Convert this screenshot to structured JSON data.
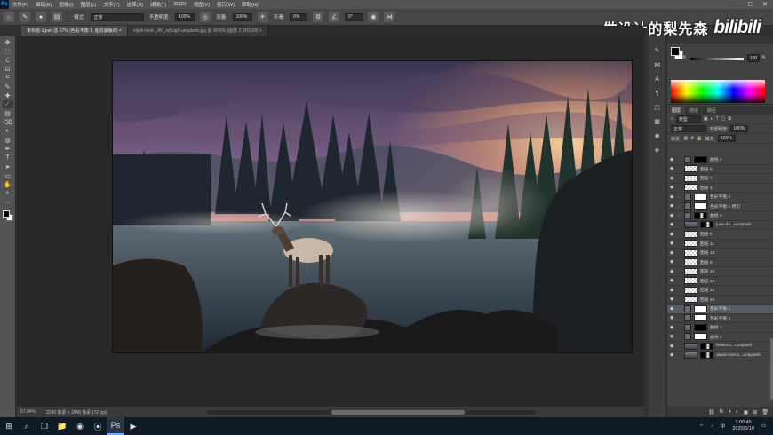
{
  "menubar": {
    "logo": "Ps",
    "items": [
      "文件(F)",
      "编辑(E)",
      "图像(I)",
      "图层(L)",
      "文字(Y)",
      "选择(S)",
      "滤镜(T)",
      "3D(D)",
      "视图(V)",
      "窗口(W)",
      "帮助(H)"
    ],
    "controls": [
      "—",
      "☐",
      "✕"
    ]
  },
  "options": {
    "mode_label": "模式:",
    "mode_value": "正常",
    "opacity_label": "不透明度:",
    "opacity_value": "100%",
    "flow_label": "流量:",
    "flow_value": "100%",
    "smooth_label": "平滑:",
    "smooth_value": "0%",
    "angle_value": "0°"
  },
  "watermark": {
    "text": "做设计的梨先森",
    "logo": "bilibili"
  },
  "tabs": [
    {
      "label": "未标题-1.psd @ 67% (色彩平衡 1, 图层蒙版/8) ×",
      "active": true
    },
    {
      "label": "elijah-hiett-_AV_xy5ug0-unsplash.jpg @ 49.5% (图层 2, RGB/8) ×",
      "active": false
    }
  ],
  "toolbar": {
    "tools": [
      "✥",
      "⬚",
      "ℒ",
      "⊡",
      "⌗",
      "✎",
      "✚",
      "⟋",
      "▤",
      "⌫",
      "◐",
      "◍",
      "✒",
      "T",
      "➤",
      "▭",
      "✋",
      "⌕",
      "⋯"
    ]
  },
  "status": {
    "zoom": "67.04%",
    "doc_info": "2280 像素 x 1848 像素 (72 ppi)"
  },
  "strip_icons": [
    "✎",
    "⋈",
    "A",
    "¶",
    "◫",
    "▦",
    "◉",
    "◈"
  ],
  "color_panel": {
    "slider_label": "K",
    "value": "100",
    "unit": "%"
  },
  "layers_panel": {
    "tabs": [
      "图层",
      "通道",
      "路径"
    ],
    "filter_label": "类型",
    "blend_mode": "正常",
    "opacity_label": "不透明度:",
    "opacity_value": "100%",
    "lock_label": "锁定:",
    "fill_label": "填充:",
    "fill_value": "100%",
    "footer_icons": [
      "⛓",
      "fx",
      "◑",
      "◐",
      "▣",
      "⊞",
      "🗑"
    ],
    "layers": [
      {
        "name": "曲线 2",
        "type": "mask-black"
      },
      {
        "name": "图层 8",
        "type": "pixel"
      },
      {
        "name": "图层 7",
        "type": "pixel"
      },
      {
        "name": "图层 4",
        "type": "pixel"
      },
      {
        "name": "色彩平衡 2",
        "type": "adj",
        "clip": true
      },
      {
        "name": "色彩平衡 1 拷贝",
        "type": "adj",
        "clip": true
      },
      {
        "name": "曲线 3",
        "type": "adj-dark",
        "clip": true
      },
      {
        "name": "juan-da...unsplash",
        "type": "photo"
      },
      {
        "name": "图层 6",
        "type": "pixel"
      },
      {
        "name": "图层 11",
        "type": "pixel"
      },
      {
        "name": "图层 10",
        "type": "pixel"
      },
      {
        "name": "图层 9",
        "type": "pixel"
      },
      {
        "name": "图层 24",
        "type": "pixel"
      },
      {
        "name": "图层 22",
        "type": "pixel"
      },
      {
        "name": "图层 21",
        "type": "pixel"
      },
      {
        "name": "图层 20",
        "type": "pixel"
      },
      {
        "name": "色彩平衡 1",
        "type": "adj",
        "selected": true
      },
      {
        "name": "色彩平衡 3",
        "type": "adj"
      },
      {
        "name": "曲线 1",
        "type": "mask-black"
      },
      {
        "name": "曲线 4",
        "type": "adj"
      },
      {
        "name": "federico...unsplash",
        "type": "photo"
      },
      {
        "name": "david-marcu...unsplash",
        "type": "photo"
      }
    ]
  },
  "taskbar": {
    "apps": [
      "⊞",
      "⌕",
      "❐",
      "📁",
      "◉",
      "⦿",
      "Ps",
      "▶"
    ],
    "tray_text": "中",
    "time": "1:00:45",
    "date": "2020/5/10"
  }
}
